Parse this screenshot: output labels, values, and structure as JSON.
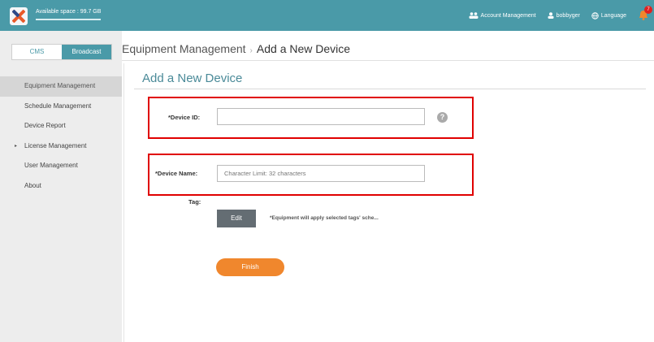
{
  "header": {
    "space_label": "Available space : 99.7 GB",
    "account_management": "Account Management",
    "username": "bobbyger",
    "language": "Language",
    "notification_count": "7"
  },
  "sidebar": {
    "tabs": {
      "cms": "CMS",
      "broadcast": "Broadcast",
      "active": "Broadcast"
    },
    "items": [
      {
        "label": "Equipment Management",
        "active": true
      },
      {
        "label": "Schedule Management"
      },
      {
        "label": "Device Report"
      },
      {
        "label": "License Management",
        "expandable": true
      },
      {
        "label": "User Management"
      },
      {
        "label": "About"
      }
    ]
  },
  "breadcrumb": {
    "parent": "Equipment Management",
    "separator": "›",
    "current": "Add a New Device"
  },
  "form": {
    "title": "Add a New Device",
    "device_id_label": "*Device ID:",
    "device_id_value": "",
    "help_icon": "?",
    "device_name_label": "*Device Name:",
    "device_name_placeholder": "Character Limit: 32 characters",
    "tag_label": "Tag:",
    "edit_label": "Edit",
    "tag_note": "*Equipment will apply selected tags' sche...",
    "finish_label": "Finish"
  },
  "colors": {
    "topbar": "#4a9aa8",
    "accent": "#4a9aa8",
    "finish": "#f0872d",
    "highlight": "#e00000",
    "badge": "#e02020"
  }
}
